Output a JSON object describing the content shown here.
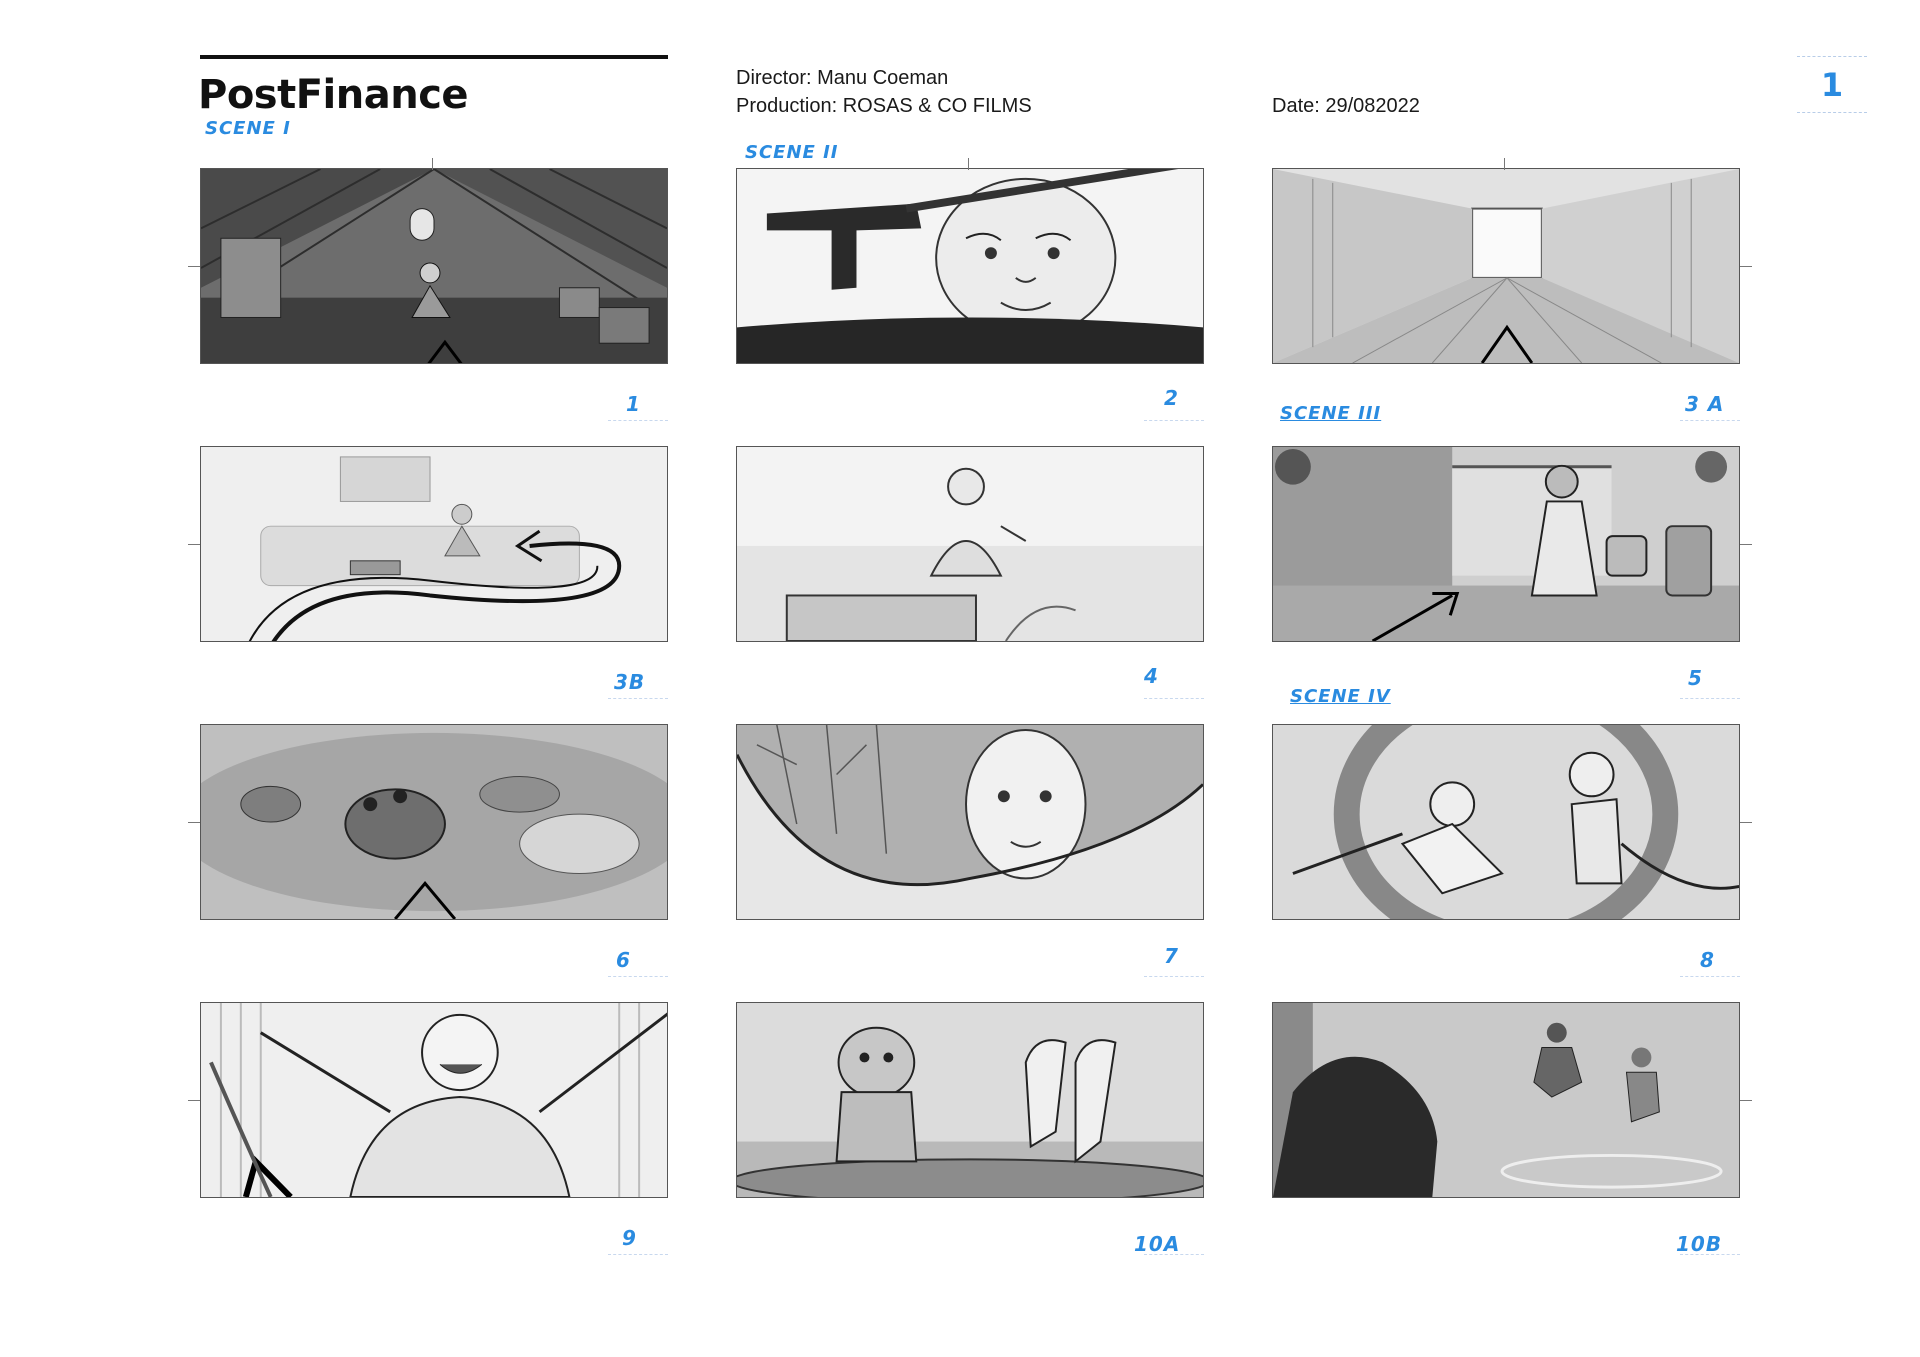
{
  "header": {
    "brand": "PostFinance",
    "director": "Director: Manu  Coeman",
    "production": "Production: ROSAS & CO FILMS",
    "date": "Date: 29/082022",
    "page_number": "1"
  },
  "scenes": [
    "SCENE I",
    "SCENE II",
    "SCENE III",
    "SCENE IV"
  ],
  "panels": [
    {
      "number": "1",
      "description_icon": "attic-girl-arrow-sketch"
    },
    {
      "number": "2",
      "description_icon": "record-player-girl-closeup-sketch"
    },
    {
      "number": "3 A",
      "description_icon": "hallway-zoom-sketch"
    },
    {
      "number": "3B",
      "description_icon": "living-room-arrow-sketch"
    },
    {
      "number": "4",
      "description_icon": "girl-record-player-sketch"
    },
    {
      "number": "5",
      "description_icon": "garden-watering-can-sketch"
    },
    {
      "number": "6",
      "description_icon": "frog-pond-sketch"
    },
    {
      "number": "7",
      "description_icon": "girl-window-closeup-sketch"
    },
    {
      "number": "8",
      "description_icon": "flying-kids-sketch"
    },
    {
      "number": "9",
      "description_icon": "girl-arms-open-sketch"
    },
    {
      "number": "10A",
      "description_icon": "dog-trampoline-feet-sketch"
    },
    {
      "number": "10B",
      "description_icon": "dog-silhouette-jumping-kids-sketch"
    }
  ]
}
